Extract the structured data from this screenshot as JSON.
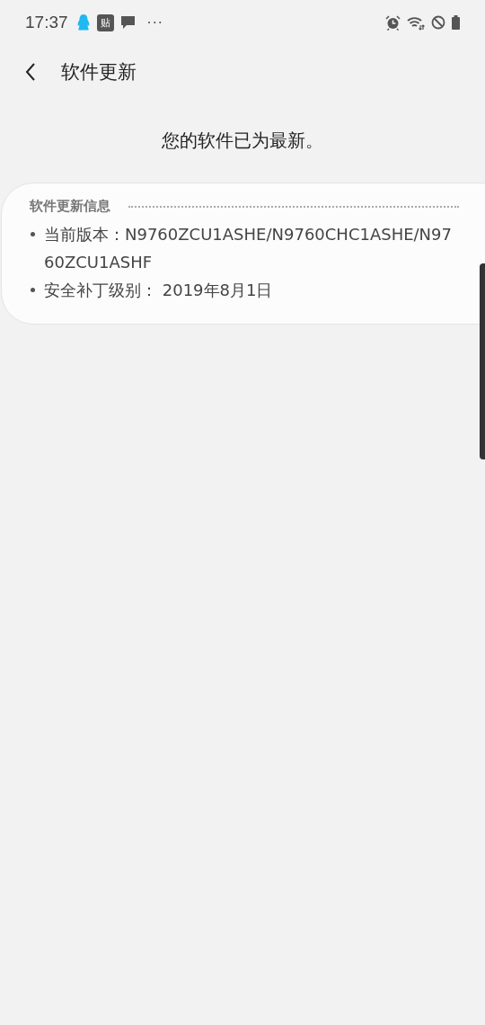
{
  "status_bar": {
    "time": "17:37",
    "notification_badge": "贴",
    "more": "···"
  },
  "header": {
    "title": "软件更新"
  },
  "message": "您的软件已为最新。",
  "info_card": {
    "title": "软件更新信息",
    "items": [
      "当前版本：N9760ZCU1ASHE/N9760CHC1ASHE/N9760ZCU1ASHF",
      "安全补丁级别： 2019年8月1日"
    ]
  }
}
